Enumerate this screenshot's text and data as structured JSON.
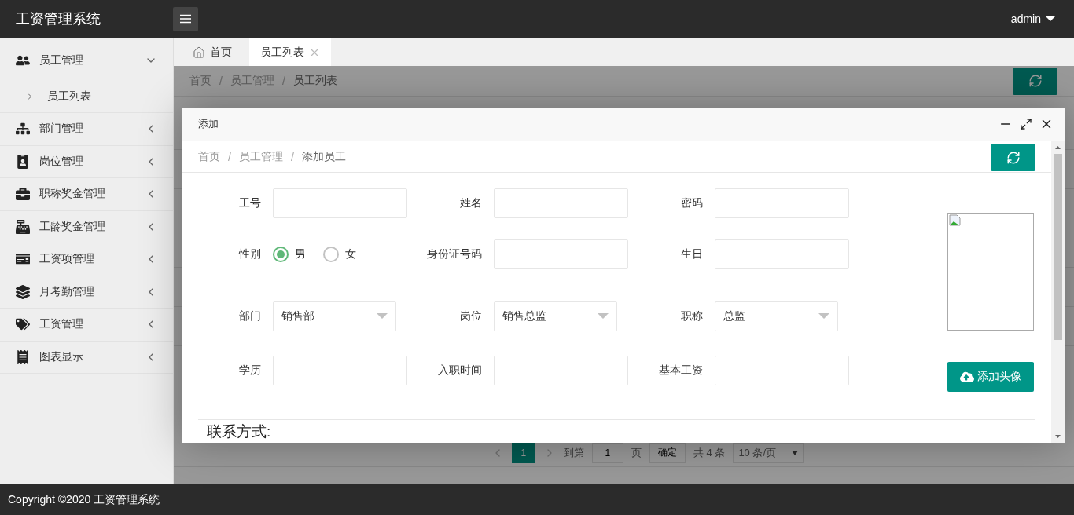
{
  "app": {
    "title": "工资管理系统",
    "user": "admin"
  },
  "sidebar": {
    "items": [
      {
        "label": "员工管理",
        "expanded": true,
        "children": [
          {
            "label": "员工列表"
          }
        ]
      },
      {
        "label": "部门管理",
        "expanded": false
      },
      {
        "label": "岗位管理",
        "expanded": false
      },
      {
        "label": "职称奖金管理",
        "expanded": false
      },
      {
        "label": "工龄奖金管理",
        "expanded": false
      },
      {
        "label": "工资项管理",
        "expanded": false
      },
      {
        "label": "月考勤管理",
        "expanded": false
      },
      {
        "label": "工资管理",
        "expanded": false
      },
      {
        "label": "图表显示",
        "expanded": false
      }
    ]
  },
  "tabs": [
    {
      "label": "首页",
      "kind": "home",
      "selected": false
    },
    {
      "label": "员工列表",
      "kind": "closable",
      "selected": true
    }
  ],
  "breadcrumb": {
    "separator": "/",
    "items": [
      "首页",
      "员工管理",
      "员工列表"
    ]
  },
  "pagination": {
    "pages": [
      {
        "label": "1",
        "selected": true
      }
    ],
    "goto_label": "到第",
    "goto_value": "1",
    "page_unit": "页",
    "confirm": "确定",
    "total": "共 4 条",
    "page_size": "10 条/页"
  },
  "dialog": {
    "title": "添加",
    "breadcrumb": {
      "separator": "/",
      "items": [
        "首页",
        "员工管理",
        "添加员工"
      ]
    },
    "form_rows": [
      {
        "fields": [
          {
            "kind": "text",
            "label": "工号"
          },
          {
            "kind": "text",
            "label": "姓名"
          },
          {
            "kind": "text",
            "label": "密码"
          }
        ]
      },
      {
        "fields": [
          {
            "kind": "radio",
            "label": "性别",
            "options": [
              {
                "label": "男",
                "selected": true
              },
              {
                "label": "女",
                "selected": false
              }
            ]
          },
          {
            "kind": "text",
            "label": "身份证号码"
          },
          {
            "kind": "text",
            "label": "生日"
          }
        ]
      },
      {
        "fields": [
          {
            "kind": "select",
            "label": "部门",
            "value": "销售部"
          },
          {
            "kind": "select",
            "label": "岗位",
            "value": "销售总监"
          },
          {
            "kind": "select",
            "label": "职称",
            "value": "总监"
          }
        ]
      },
      {
        "fields": [
          {
            "kind": "text",
            "label": "学历"
          },
          {
            "kind": "text",
            "label": "入职时间"
          },
          {
            "kind": "text",
            "label": "基本工资"
          }
        ]
      }
    ],
    "avatar_button": "添加头像",
    "section_title": "联系方式:"
  },
  "footer": "Copyright ©2020 工资管理系统"
}
